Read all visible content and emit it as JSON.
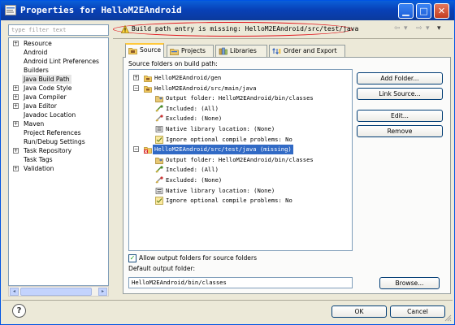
{
  "window": {
    "title": "Properties for HelloM2EAndroid"
  },
  "sidebar": {
    "filter_placeholder": "type filter text",
    "items": [
      {
        "label": "Resource",
        "expand": "+"
      },
      {
        "label": "Android",
        "expand": ""
      },
      {
        "label": "Android Lint Preferences",
        "expand": ""
      },
      {
        "label": "Builders",
        "expand": ""
      },
      {
        "label": "Java Build Path",
        "expand": ""
      },
      {
        "label": "Java Code Style",
        "expand": "+"
      },
      {
        "label": "Java Compiler",
        "expand": "+"
      },
      {
        "label": "Java Editor",
        "expand": "+"
      },
      {
        "label": "Javadoc Location",
        "expand": ""
      },
      {
        "label": "Maven",
        "expand": "+"
      },
      {
        "label": "Project References",
        "expand": ""
      },
      {
        "label": "Run/Debug Settings",
        "expand": ""
      },
      {
        "label": "Task Repository",
        "expand": "+"
      },
      {
        "label": "Task Tags",
        "expand": ""
      },
      {
        "label": "Validation",
        "expand": "+"
      }
    ],
    "selected": "Java Build Path"
  },
  "header": {
    "message": "Build path entry is missing: HelloM2EAndroid/src/test/java",
    "back_arrow": "⇦",
    "forward_arrow": "⇨",
    "menu_arrow": "▾"
  },
  "tabs": [
    {
      "label": "Source",
      "icon": "source-folder-icon"
    },
    {
      "label": "Projects",
      "icon": "projects-icon"
    },
    {
      "label": "Libraries",
      "icon": "libraries-icon"
    },
    {
      "label": "Order and Export",
      "icon": "order-export-icon"
    }
  ],
  "source": {
    "label": "Source folders on build path:",
    "tree": [
      {
        "text": "HelloM2EAndroid/gen",
        "level": 0,
        "icon": "source-folder-icon",
        "expand": "+"
      },
      {
        "text": "HelloM2EAndroid/src/main/java",
        "level": 0,
        "icon": "source-folder-icon",
        "expand": "−"
      },
      {
        "text": "Output folder: HelloM2EAndroid/bin/classes",
        "level": 1,
        "icon": "output-folder-icon"
      },
      {
        "text": "Included: (All)",
        "level": 1,
        "icon": "included-icon"
      },
      {
        "text": "Excluded: (None)",
        "level": 1,
        "icon": "excluded-icon"
      },
      {
        "text": "Native library location: (None)",
        "level": 1,
        "icon": "native-library-icon"
      },
      {
        "text": "Ignore optional compile problems: No",
        "level": 1,
        "icon": "ignore-problems-icon"
      },
      {
        "text": "HelloM2EAndroid/src/test/java (missing)",
        "level": 0,
        "icon": "missing-folder-icon",
        "expand": "−",
        "selected": true
      },
      {
        "text": "Output folder: HelloM2EAndroid/bin/classes",
        "level": 1,
        "icon": "output-folder-icon"
      },
      {
        "text": "Included: (All)",
        "level": 1,
        "icon": "included-icon"
      },
      {
        "text": "Excluded: (None)",
        "level": 1,
        "icon": "excluded-icon"
      },
      {
        "text": "Native library location: (None)",
        "level": 1,
        "icon": "native-library-icon"
      },
      {
        "text": "Ignore optional compile problems: No",
        "level": 1,
        "icon": "ignore-problems-icon"
      }
    ],
    "buttons": {
      "add_folder": "Add Folder...",
      "link_source": "Link Source...",
      "edit": "Edit...",
      "remove": "Remove"
    },
    "allow_output_label": "Allow output folders for source folders",
    "allow_output_checked": true,
    "default_output_label": "Default output folder:",
    "default_output_value": "HelloM2EAndroid/bin/classes",
    "browse": "Browse..."
  },
  "footer": {
    "help": "?",
    "ok": "OK",
    "cancel": "Cancel"
  },
  "colors": {
    "title_bar": "#0841b8",
    "selection": "#316ac5",
    "warning_outline": "#e0121a",
    "dialog_bg": "#ece9d8"
  }
}
